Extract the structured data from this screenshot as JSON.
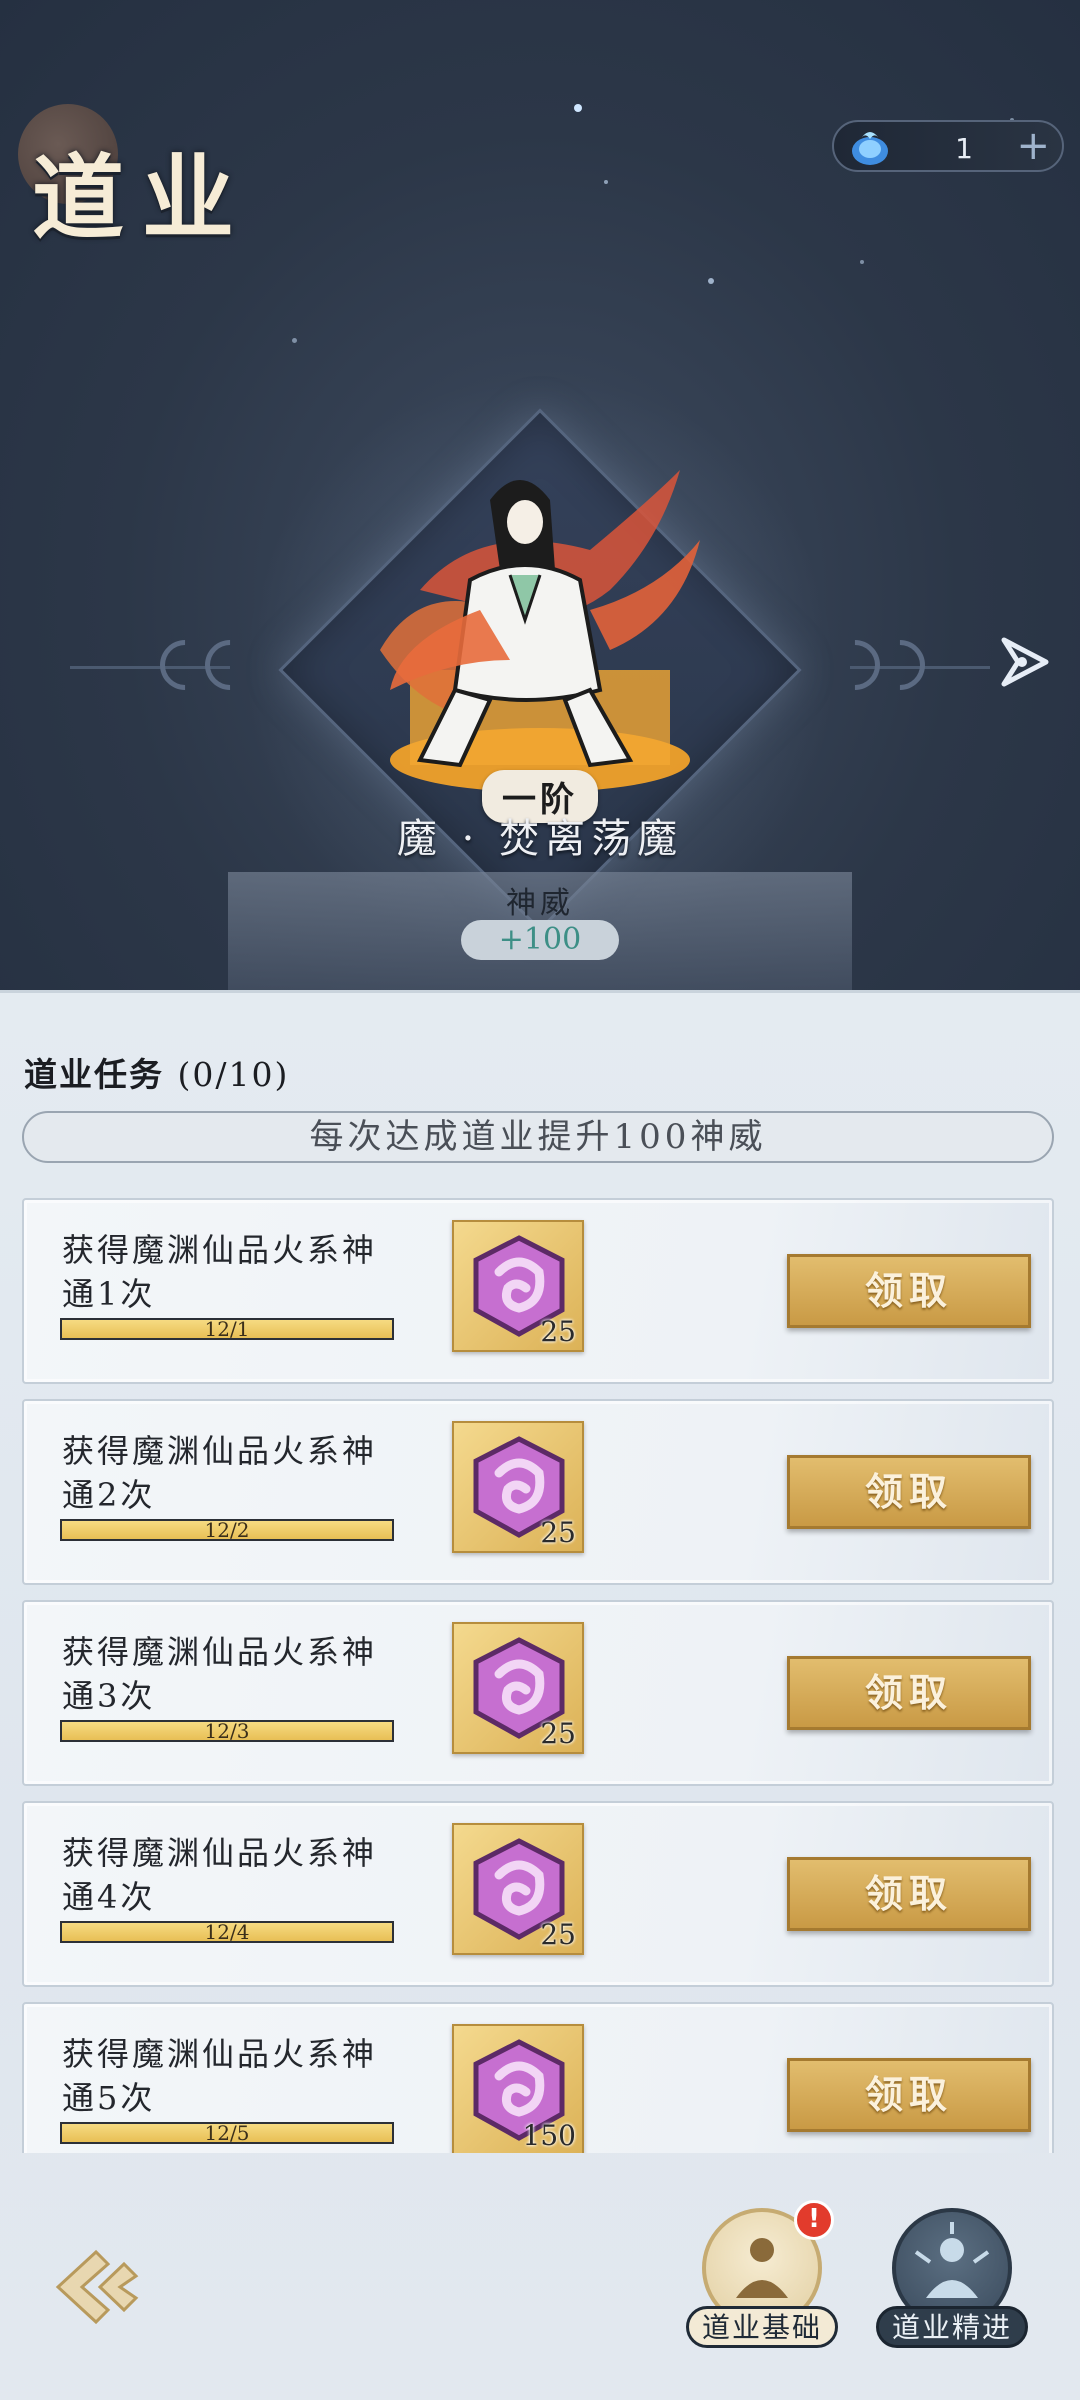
{
  "header": {
    "title": "道业",
    "currency": {
      "icon": "spirit-flame-icon",
      "count": "1",
      "add_label": "+"
    }
  },
  "skill": {
    "rank": "一阶",
    "name": "魔 · 焚离荡魔",
    "power_label": "神威",
    "power_value": "+100"
  },
  "tasks_panel": {
    "title": "道业任务",
    "count": "(0/10)",
    "banner": "每次达成道业提升100神威",
    "tasks": [
      {
        "label": "获得魔渊仙品火系神通1次",
        "progress_text": "12/1",
        "progress": 1.0,
        "reward_count": "25",
        "button": "领取"
      },
      {
        "label": "获得魔渊仙品火系神通2次",
        "progress_text": "12/2",
        "progress": 1.0,
        "reward_count": "25",
        "button": "领取"
      },
      {
        "label": "获得魔渊仙品火系神通3次",
        "progress_text": "12/3",
        "progress": 1.0,
        "reward_count": "25",
        "button": "领取"
      },
      {
        "label": "获得魔渊仙品火系神通4次",
        "progress_text": "12/4",
        "progress": 1.0,
        "reward_count": "25",
        "button": "领取"
      },
      {
        "label": "获得魔渊仙品火系神通5次",
        "progress_text": "12/5",
        "progress": 1.0,
        "reward_count": "150",
        "button": "领取"
      }
    ]
  },
  "bottom_nav": {
    "basic_label": "道业基础",
    "basic_badge": "!",
    "advanced_label": "道业精进"
  },
  "colors": {
    "accent_gold": "#d4a94f",
    "progress_fill": "#f0cd6a",
    "power_teal": "#3d8f86",
    "badge_red": "#e23b2c"
  }
}
